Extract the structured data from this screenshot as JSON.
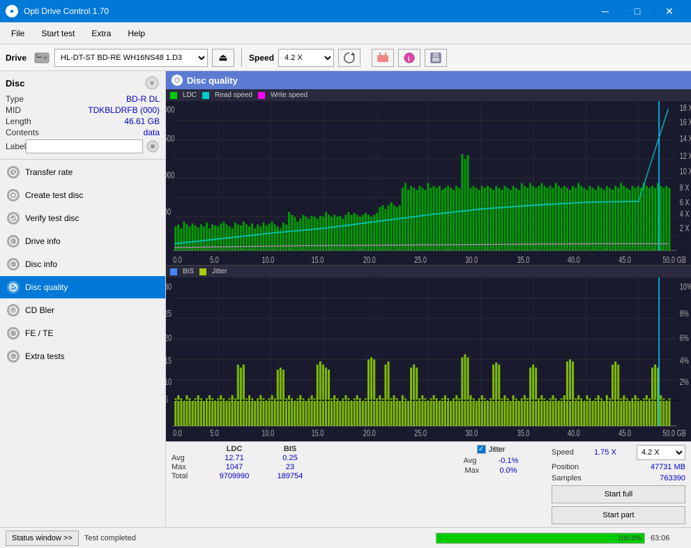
{
  "titlebar": {
    "title": "Opti Drive Control 1.70",
    "icon": "●",
    "minimize": "─",
    "maximize": "□",
    "close": "✕"
  },
  "menubar": {
    "items": [
      "File",
      "Start test",
      "Extra",
      "Help"
    ]
  },
  "toolbar": {
    "drive_label": "Drive",
    "drive_value": "HL-DT-ST BD-RE  WH16NS48 1.D3",
    "speed_label": "Speed",
    "speed_value": "4.2 X"
  },
  "disc": {
    "title": "Disc",
    "type_label": "Type",
    "type_value": "BD-R DL",
    "mid_label": "MID",
    "mid_value": "TDKBLDRFB (000)",
    "length_label": "Length",
    "length_value": "46.61 GB",
    "contents_label": "Contents",
    "contents_value": "data",
    "label_label": "Label"
  },
  "nav": {
    "items": [
      {
        "id": "transfer-rate",
        "label": "Transfer rate"
      },
      {
        "id": "create-test-disc",
        "label": "Create test disc"
      },
      {
        "id": "verify-test-disc",
        "label": "Verify test disc"
      },
      {
        "id": "drive-info",
        "label": "Drive info"
      },
      {
        "id": "disc-info",
        "label": "Disc info"
      },
      {
        "id": "disc-quality",
        "label": "Disc quality",
        "active": true
      },
      {
        "id": "cd-bler",
        "label": "CD Bler"
      },
      {
        "id": "fe-te",
        "label": "FE / TE"
      },
      {
        "id": "extra-tests",
        "label": "Extra tests"
      }
    ]
  },
  "dq": {
    "title": "Disc quality",
    "legend": {
      "ldc_label": "LDC",
      "read_label": "Read speed",
      "write_label": "Write speed",
      "bis_label": "BIS",
      "jitter_label": "Jitter"
    }
  },
  "stats": {
    "headers": [
      "",
      "LDC",
      "BIS"
    ],
    "avg_label": "Avg",
    "avg_ldc": "12.71",
    "avg_bis": "0.25",
    "max_label": "Max",
    "max_ldc": "1047",
    "max_bis": "23",
    "total_label": "Total",
    "total_ldc": "9709990",
    "total_bis": "189754",
    "jitter_label": "Jitter",
    "jitter_avg": "-0.1%",
    "jitter_max": "0.0%",
    "speed_label": "Speed",
    "speed_value": "1.75 X",
    "position_label": "Position",
    "position_value": "47731 MB",
    "samples_label": "Samples",
    "samples_value": "763390",
    "speed_select": "4.2 X",
    "start_full_label": "Start full",
    "start_part_label": "Start part"
  },
  "statusbar": {
    "status_window_label": "Status window >>",
    "status_text": "Test completed",
    "progress_pct": "100.0%",
    "time": "63:06"
  }
}
